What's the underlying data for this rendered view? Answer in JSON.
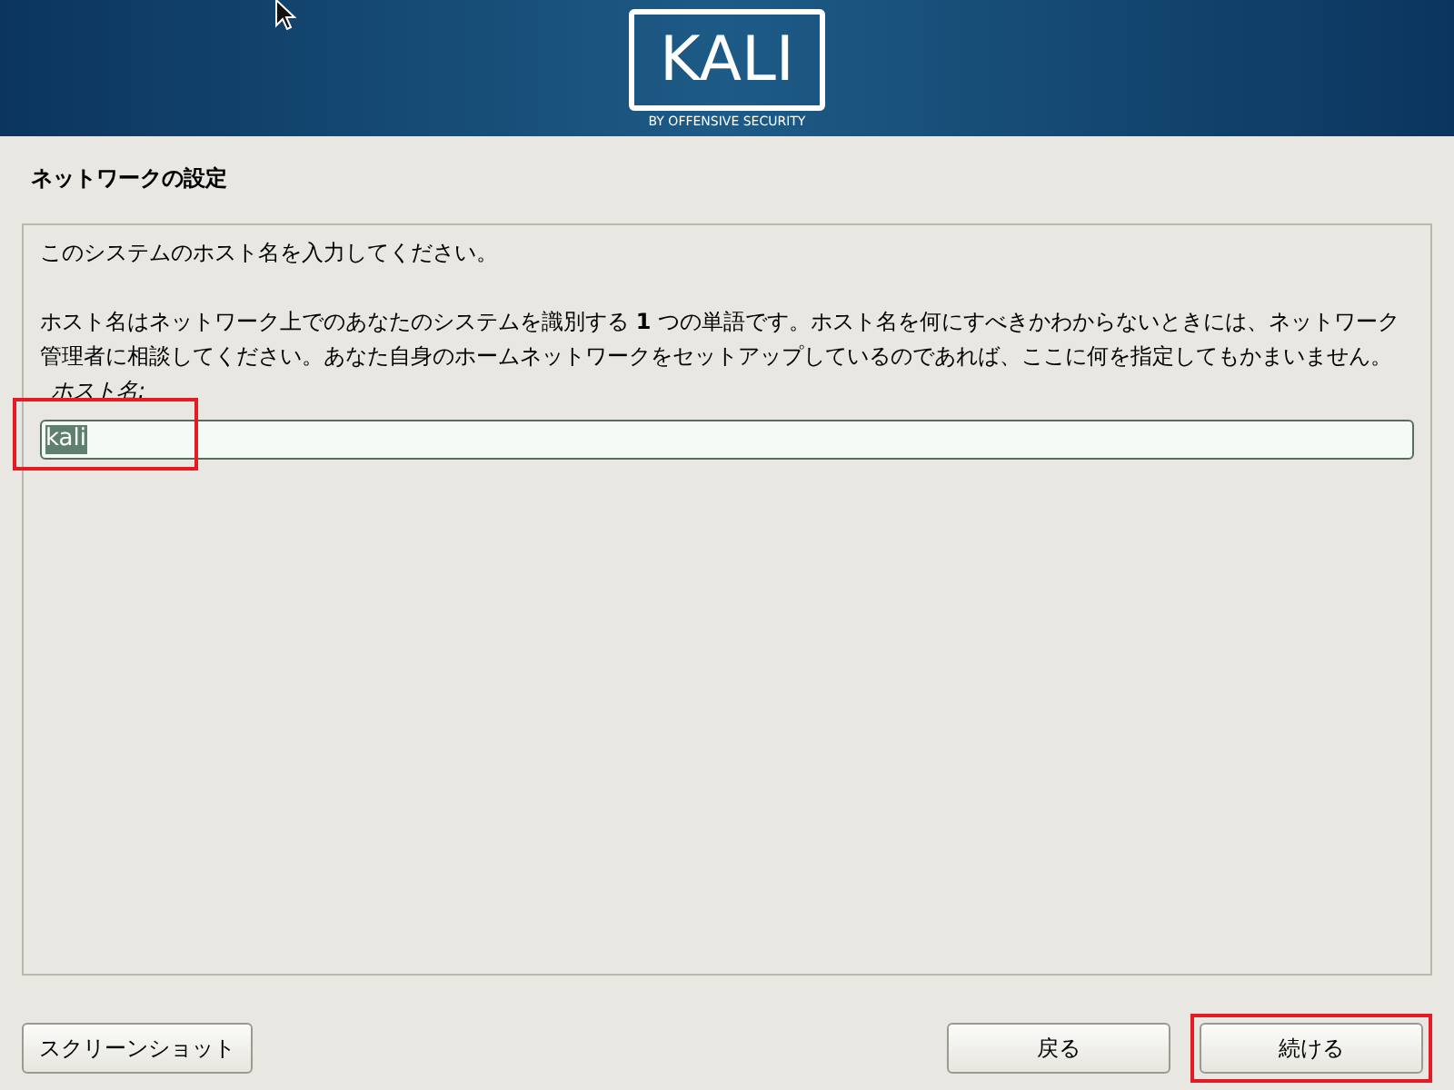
{
  "banner": {
    "logo_text": "KALI",
    "tagline": "BY OFFENSIVE SECURITY"
  },
  "title": "ネットワークの設定",
  "panel": {
    "intro": "このシステムのホスト名を入力してください。",
    "description": "ホスト名はネットワーク上でのあなたのシステムを識別する **1** つの単語です。ホスト名を何にすべきかわからないときには、ネットワーク管理者に相談してください。あなた自身のホームネットワークをセットアップしているのであれば、ここに何を指定してもかまいません。",
    "field": {
      "label": "ホスト名:",
      "value": "kali",
      "selected": true,
      "highlighted": true
    }
  },
  "buttons": [
    {
      "label": "スクリーンショット",
      "highlighted": false
    },
    {
      "label": "戻る",
      "highlighted": false
    },
    {
      "label": "続ける",
      "highlighted": true
    }
  ]
}
